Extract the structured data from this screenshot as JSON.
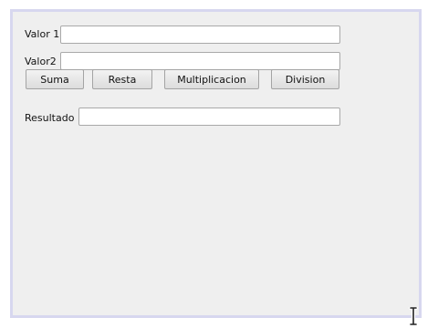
{
  "form": {
    "valor1_label": "Valor 1",
    "valor1_value": "",
    "valor2_label": "Valor2",
    "valor2_value": "",
    "resultado_label": "Resultado",
    "resultado_value": ""
  },
  "buttons": {
    "suma": "Suma",
    "resta": "Resta",
    "multiplicacion": "Multiplicacion",
    "division": "Division"
  },
  "icons": {
    "cursor": "text-cursor-icon"
  },
  "colors": {
    "panel_background": "#efefef",
    "panel_border": "#d7d7ef"
  }
}
